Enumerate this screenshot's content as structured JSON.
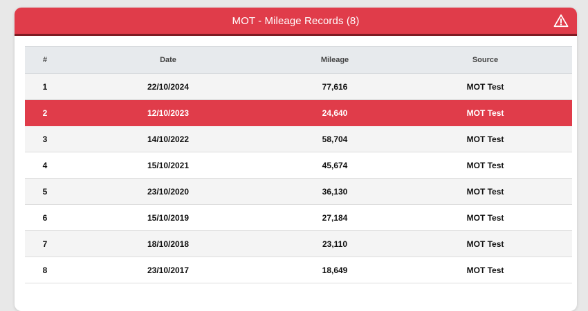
{
  "header": {
    "title": "MOT - Mileage Records (8)",
    "icon": "warning-triangle-icon",
    "color": "#e03c4a"
  },
  "table": {
    "columns": [
      "#",
      "Date",
      "Mileage",
      "Source"
    ],
    "rows": [
      {
        "num": "1",
        "date": "22/10/2024",
        "mileage": "77,616",
        "source": "MOT Test"
      },
      {
        "num": "2",
        "date": "12/10/2023",
        "mileage": "24,640",
        "source": "MOT Test"
      },
      {
        "num": "3",
        "date": "14/10/2022",
        "mileage": "58,704",
        "source": "MOT Test"
      },
      {
        "num": "4",
        "date": "15/10/2021",
        "mileage": "45,674",
        "source": "MOT Test"
      },
      {
        "num": "5",
        "date": "23/10/2020",
        "mileage": "36,130",
        "source": "MOT Test"
      },
      {
        "num": "6",
        "date": "15/10/2019",
        "mileage": "27,184",
        "source": "MOT Test"
      },
      {
        "num": "7",
        "date": "18/10/2018",
        "mileage": "23,110",
        "source": "MOT Test"
      },
      {
        "num": "8",
        "date": "23/10/2017",
        "mileage": "18,649",
        "source": "MOT Test"
      }
    ],
    "highlight_color": "#e03c4a"
  }
}
